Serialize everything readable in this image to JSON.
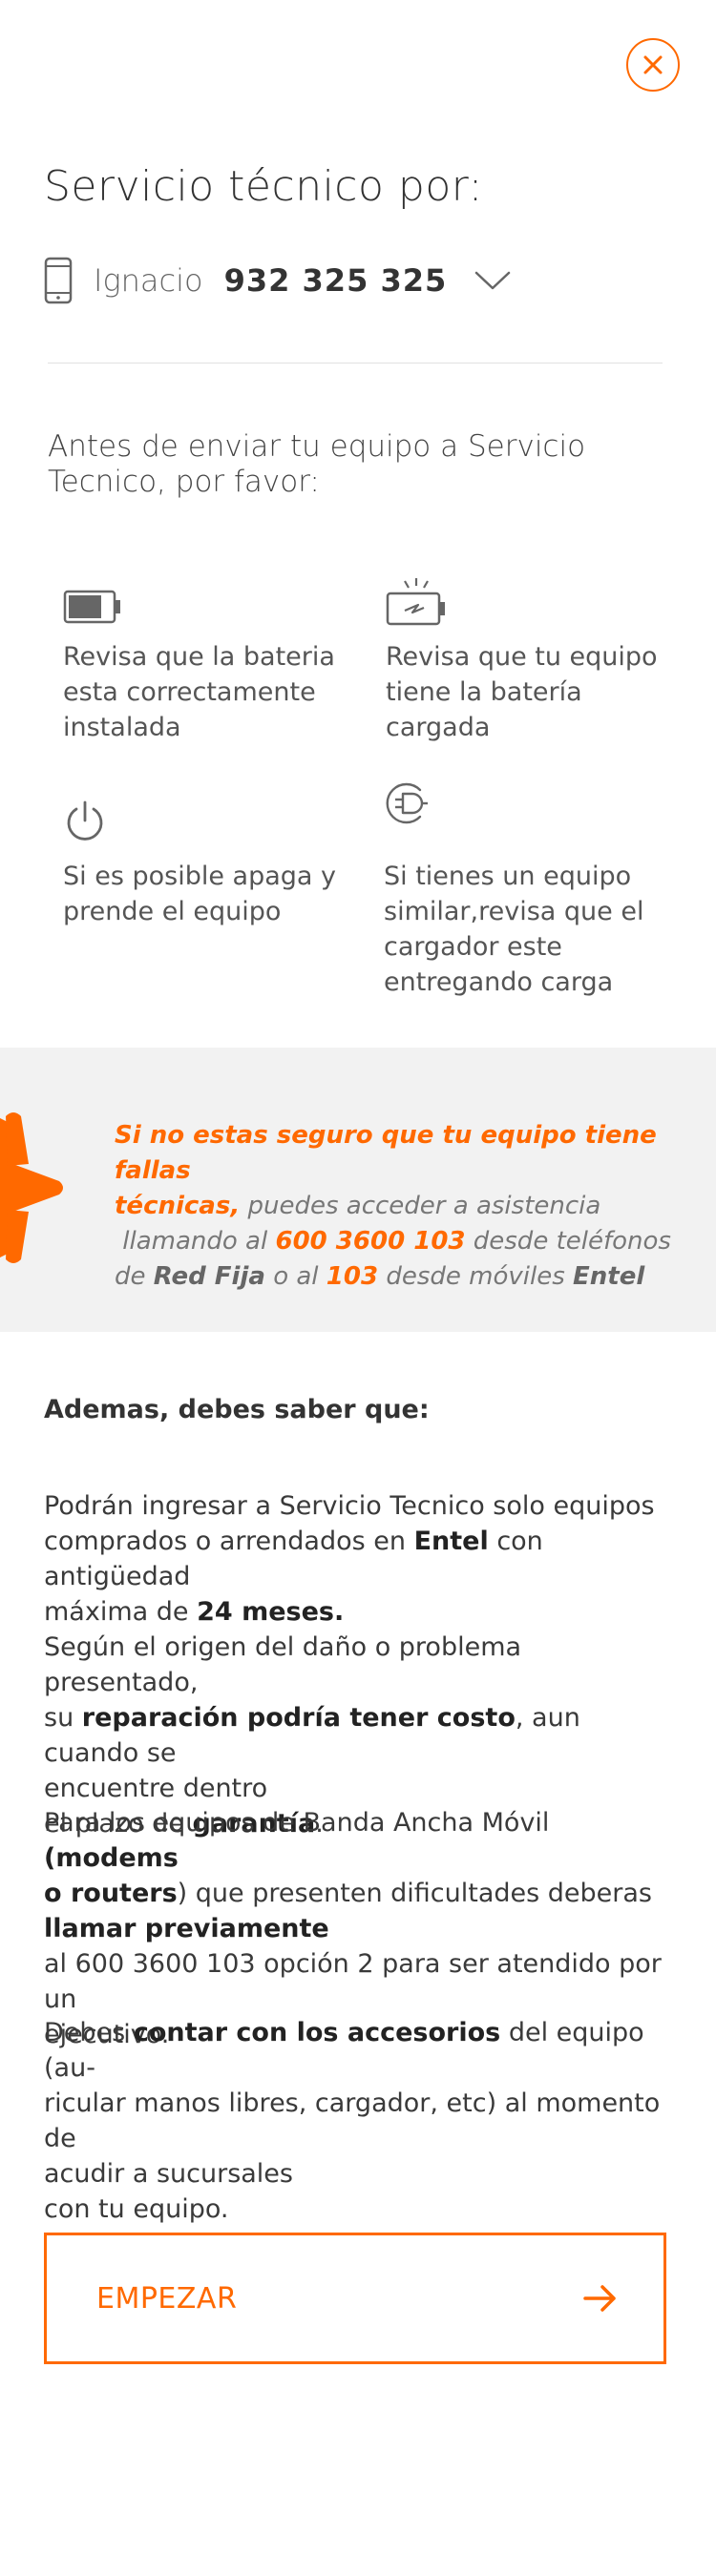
{
  "header": {
    "title": "Servicio técnico por:",
    "line_name": "Ignacio",
    "line_number": "932 325 325"
  },
  "intro": {
    "line1": "Antes de enviar tu equipo a Servicio",
    "line2": "Tecnico, por favor:"
  },
  "tips": [
    {
      "icon": "battery-icon",
      "lines": [
        "Revisa que la bateria",
        "esta correctamente",
        "instalada"
      ]
    },
    {
      "icon": "battery-charging-icon",
      "lines": [
        "Revisa que tu equipo",
        "tiene la batería",
        "cargada"
      ]
    },
    {
      "icon": "power-icon",
      "lines": [
        "Si es posible apaga y",
        "prende el equipo"
      ]
    },
    {
      "icon": "charger-plug-icon",
      "lines": [
        "Si tienes un equipo",
        "similar,revisa que el",
        "cargador este",
        "entregando carga"
      ]
    }
  ],
  "promo": {
    "highlight": "Si no estas seguro que tu equipo tiene fallas",
    "highlight2": "técnicas,",
    "text1": "puedes acceder a asistencia",
    "text2": "llamando al",
    "number1": "600 3600 103",
    "text3": "desde teléfonos",
    "text4": "de",
    "brand1": "Red Fija",
    "text5": "o al",
    "number2": "103",
    "text6": "desde móviles",
    "brand2": "Entel"
  },
  "info": {
    "title": "Ademas, debes saber que:",
    "p1": {
      "l1": "Podrán ingresar a Servicio Tecnico solo equipos",
      "l2a": "comprados o arrendados en",
      "l2b": "Entel",
      "l2c": "con antigüedad",
      "l3a": "máxima de",
      "l3b": "24 meses."
    },
    "p2": {
      "l1": "Según el origen del daño o problema presentado,",
      "l2a": "su",
      "l2b": "reparación podría tener costo",
      "l2c": ", aun cuando se",
      "l3": "encuentre dentro",
      "l4a": "el plazo de",
      "l4b": "garantía",
      "l4c": "."
    },
    "p3": {
      "l1a": "Para los equipos de Banda Ancha Móvil",
      "l1b": "(modems",
      "l2a": "o routers",
      "l2b": ") que presenten dificultades deberas",
      "l3": "llamar previamente",
      "l4": "al 600 3600 103 opción 2 para ser atendido por un",
      "l5": "ejecutivo."
    },
    "p4": {
      "l1a": "Debes",
      "l1b": "contar con los accesorios",
      "l1c": "del equipo (au-",
      "l2": "ricular manos libres, cargador, etc) al momento de",
      "l3": "acudir a sucursales",
      "l4": "con tu equipo."
    }
  },
  "cta": {
    "label": "EMPEZAR"
  },
  "colors": {
    "accent": "#ff6900",
    "panel": "#f2f2f2",
    "text": "#3a3a3a"
  }
}
